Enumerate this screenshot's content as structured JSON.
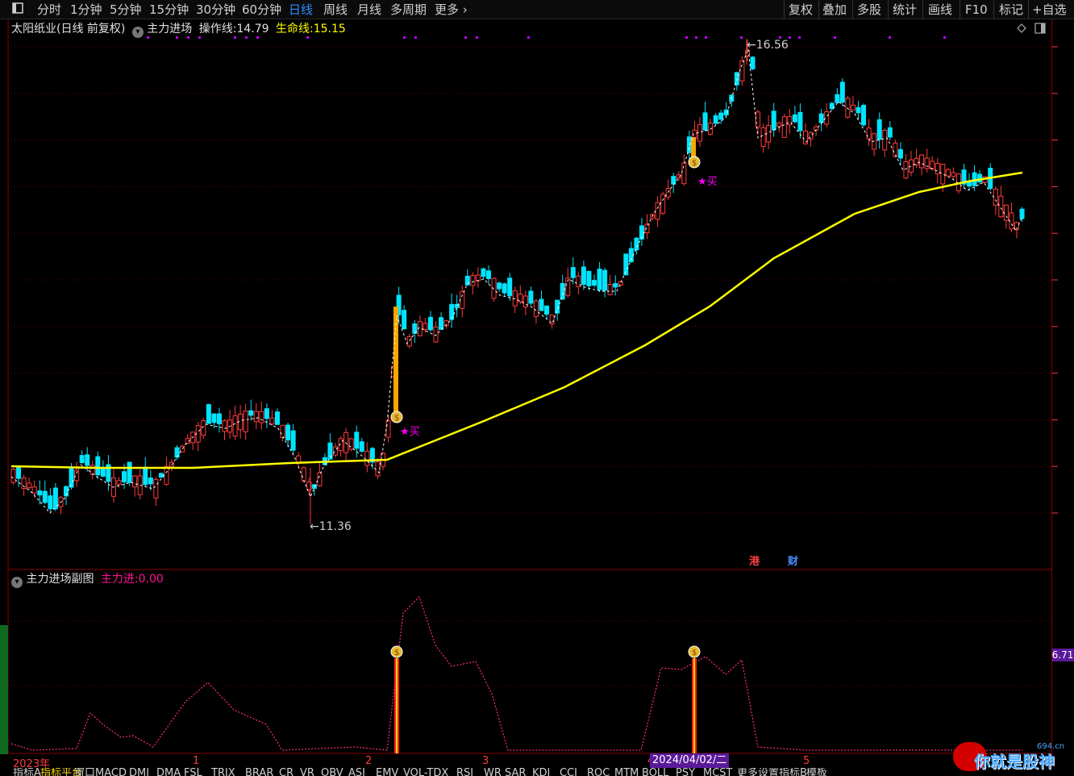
{
  "toolbar": {
    "items": [
      {
        "label": "分时",
        "active": false
      },
      {
        "label": "1分钟",
        "active": false
      },
      {
        "label": "5分钟",
        "active": false
      },
      {
        "label": "15分钟",
        "active": false
      },
      {
        "label": "30分钟",
        "active": false
      },
      {
        "label": "60分钟",
        "active": false
      },
      {
        "label": "日线",
        "active": true
      },
      {
        "label": "周线",
        "active": false
      },
      {
        "label": "月线",
        "active": false
      },
      {
        "label": "多周期",
        "active": false
      },
      {
        "label": "更多",
        "active": false
      }
    ],
    "right_items": [
      "复权",
      "叠加",
      "多股",
      "统计",
      "画线",
      "F10",
      "标记",
      "+自选"
    ],
    "more_chevron": "›"
  },
  "main_chart": {
    "stock_title": "太阳纸业(日线 前复权)",
    "indicator_name": "主力进场",
    "op_line_label": "操作线:",
    "op_line_value": "14.79",
    "life_line_label": "生命线:",
    "life_line_value": "15.15",
    "high_label": "16.56",
    "low_label": "11.36",
    "buy_label": "★买",
    "tag_hk": "港",
    "tag_fin": "财"
  },
  "sub_chart": {
    "name": "主力进场副图",
    "value_label": "主力进:",
    "value": "0.00",
    "right_value": "6.71"
  },
  "time_axis": {
    "labels": [
      "2023年",
      "1",
      "2",
      "3",
      "4",
      "5"
    ],
    "highlight": "2024/04/02/二"
  },
  "bottom_tabs": [
    "指标A",
    "指标平台",
    "窗口",
    "MACD",
    "DMI",
    "DMA",
    "FSL",
    "TRIX",
    "BRAR",
    "CR",
    "VR",
    "OBV",
    "ASI",
    "EMV",
    "VOL-TDX",
    "RSI",
    "WR",
    "SAR",
    "KDJ",
    "CCI",
    "ROC",
    "MTM",
    "BOLL",
    "PSY",
    "MCST",
    "更多",
    "设置",
    "指标B",
    "模板"
  ],
  "watermark": {
    "brand": "你就是股神",
    "site": "694.cn"
  },
  "colors": {
    "up": "#ff3b3b",
    "down": "#00e5ff",
    "life": "#ffff00",
    "buy": "#ff00ff",
    "active": "#2f8cff"
  }
}
